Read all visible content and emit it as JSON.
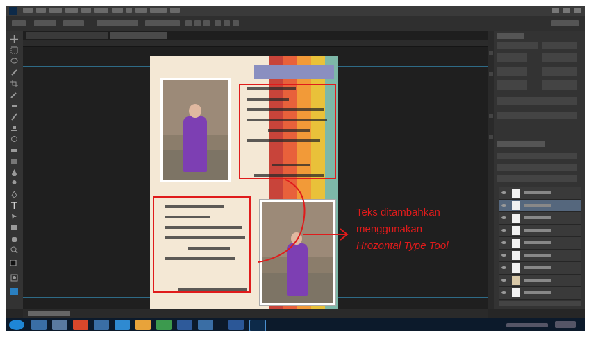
{
  "annotation": {
    "line1": "Teks ditambahkan",
    "line2": "menggunakan",
    "line3": "Hrozontal Type Tool",
    "color": "#e01b1b"
  },
  "app": {
    "logo_icon": "photoshop-logo-icon"
  },
  "colors": {
    "stripes": [
      "#c8443a",
      "#e8613b",
      "#f29a38",
      "#e9c13a",
      "#7db8a8"
    ],
    "paper": "#f4e8d5",
    "highlight": "#e01b1b"
  }
}
